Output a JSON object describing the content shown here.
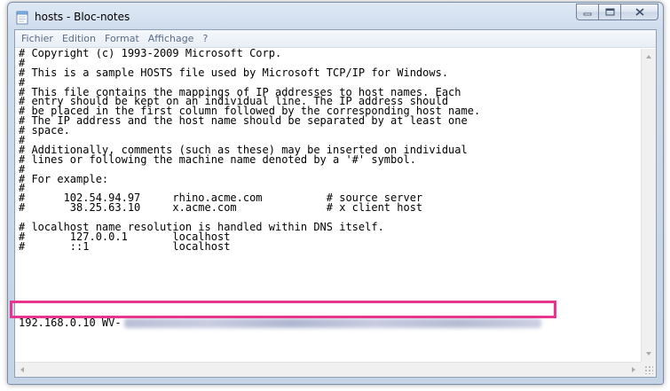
{
  "window": {
    "title": "hosts - Bloc-notes"
  },
  "menu": {
    "items": [
      "Fichier",
      "Edition",
      "Format",
      "Affichage",
      "?"
    ]
  },
  "editor": {
    "lines": [
      "# Copyright (c) 1993-2009 Microsoft Corp.",
      "#",
      "# This is a sample HOSTS file used by Microsoft TCP/IP for Windows.",
      "#",
      "# This file contains the mappings of IP addresses to host names. Each",
      "# entry should be kept on an individual line. The IP address should",
      "# be placed in the first column followed by the corresponding host name.",
      "# The IP address and the host name should be separated by at least one",
      "# space.",
      "#",
      "# Additionally, comments (such as these) may be inserted on individual",
      "# lines or following the machine name denoted by a '#' symbol.",
      "#",
      "# For example:",
      "#",
      "#      102.54.94.97     rhino.acme.com          # source server",
      "#       38.25.63.10     x.acme.com              # x client host",
      "",
      "# localhost name resolution is handled within DNS itself.",
      "#       127.0.0.1       localhost",
      "#       ::1             localhost"
    ],
    "highlighted_line_prefix": "192.168.0.10 WV-"
  },
  "colors": {
    "highlight_border": "#e8368f"
  }
}
